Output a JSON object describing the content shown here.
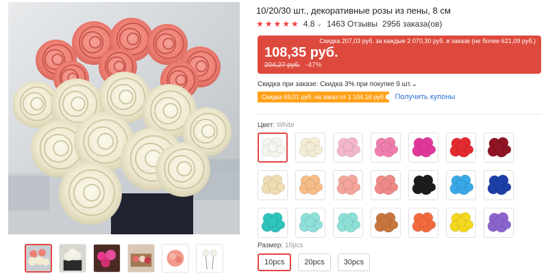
{
  "product": {
    "title": "10/20/30 шт., декоративные розы из пены, 8 см",
    "rating": "4.8",
    "stars": "★★★★★",
    "rating_chevron": "⌄",
    "reviews": "1463 Отзывы",
    "orders": "2956 заказа(ов)"
  },
  "price": {
    "discount_line": "Скидка 207,03 руб. за каждые 2 070,30 руб. в заказе (не более 621,09 руб.)",
    "current": "108,35 руб.",
    "old": "204,27 руб.",
    "percent": "-47%"
  },
  "bulk_discount": "Скидка при заказе: Скидка 3% при покупке 9 шт.⌄",
  "coupon": {
    "tag": "Скидка 69,01 руб. на заказ от 1 104,16 руб.",
    "link": "Получить купоны"
  },
  "color": {
    "label": "Цвет: ",
    "selected": "White",
    "options": [
      {
        "hex": "#f6f4ee"
      },
      {
        "hex": "#f3ecd4"
      },
      {
        "hex": "#f2b7cc"
      },
      {
        "hex": "#f07fae"
      },
      {
        "hex": "#e0389a"
      },
      {
        "hex": "#e32a2f"
      },
      {
        "hex": "#8f1424"
      },
      {
        "hex": "#f0dcb4"
      },
      {
        "hex": "#f6bc88"
      },
      {
        "hex": "#f3a59c"
      },
      {
        "hex": "#ee8a88"
      },
      {
        "hex": "#1c1c1e"
      },
      {
        "hex": "#38a9e6"
      },
      {
        "hex": "#1c3fa8"
      },
      {
        "hex": "#2fc3bd"
      },
      {
        "hex": "#8fe0d9"
      },
      {
        "hex": "#8de0d6"
      },
      {
        "hex": "#c8763e"
      },
      {
        "hex": "#f26b3d"
      },
      {
        "hex": "#f4d820"
      },
      {
        "hex": "#8a64cc"
      }
    ]
  },
  "size": {
    "label": "Размер: ",
    "selected": "10pcs",
    "options": [
      "10pcs",
      "20pcs",
      "30pcs"
    ]
  },
  "theme": {
    "accent": "#e34343",
    "price_bg": "#dd4a3d",
    "coupon_bg": "#ffa21a",
    "link": "#2a6fd1",
    "star": "#f23b3b"
  }
}
